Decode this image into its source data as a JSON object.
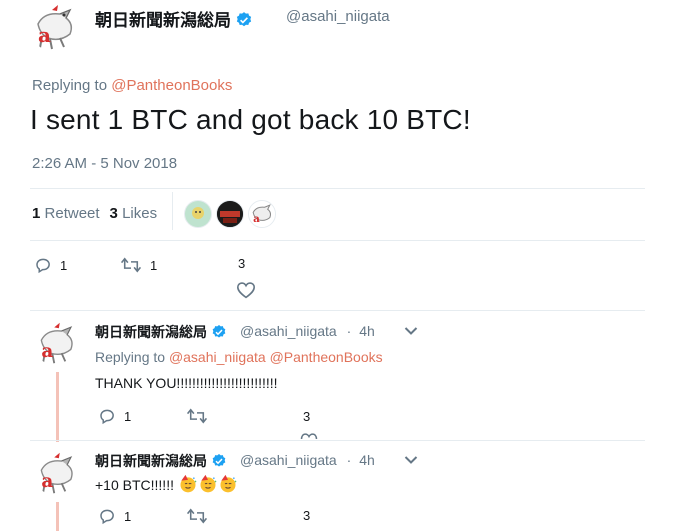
{
  "main_tweet": {
    "display_name": "朝日新聞新潟総局",
    "handle": "@asahi_niigata",
    "replying_prefix": "Replying to ",
    "replying_to": "@PantheonBooks",
    "text": "I sent 1 BTC and got back 10 BTC!",
    "timestamp": "2:26 AM - 5 Nov 2018",
    "retweet_count": "1",
    "retweet_label": "Retweet",
    "like_count": "3",
    "like_label": "Likes",
    "actions": {
      "reply_count": "1",
      "retweet_count": "1",
      "like_count": "3"
    }
  },
  "replies": [
    {
      "display_name": "朝日新聞新潟総局",
      "handle": "@asahi_niigata",
      "dot": "·",
      "time_ago": "4h",
      "replying_prefix": "Replying to ",
      "replying_to_1": "@asahi_niigata",
      "replying_to_2": "@PantheonBooks",
      "text": "THANK YOU!!!!!!!!!!!!!!!!!!!!!!!!!!",
      "reply_count": "1",
      "like_count": "3"
    },
    {
      "display_name": "朝日新聞新潟総局",
      "handle": "@asahi_niigata",
      "dot": "·",
      "time_ago": "4h",
      "text": "+10 BTC!!!!!!",
      "reply_count": "1",
      "like_count": "3"
    }
  ],
  "colors": {
    "link": "#e0735b",
    "verified": "#1da1f2",
    "muted": "#657786",
    "thread_line": "#f4c2b8"
  },
  "icons": [
    "verified-badge-icon",
    "reply-icon",
    "retweet-icon",
    "heart-icon",
    "chevron-down-icon",
    "partying-face-emoji"
  ]
}
